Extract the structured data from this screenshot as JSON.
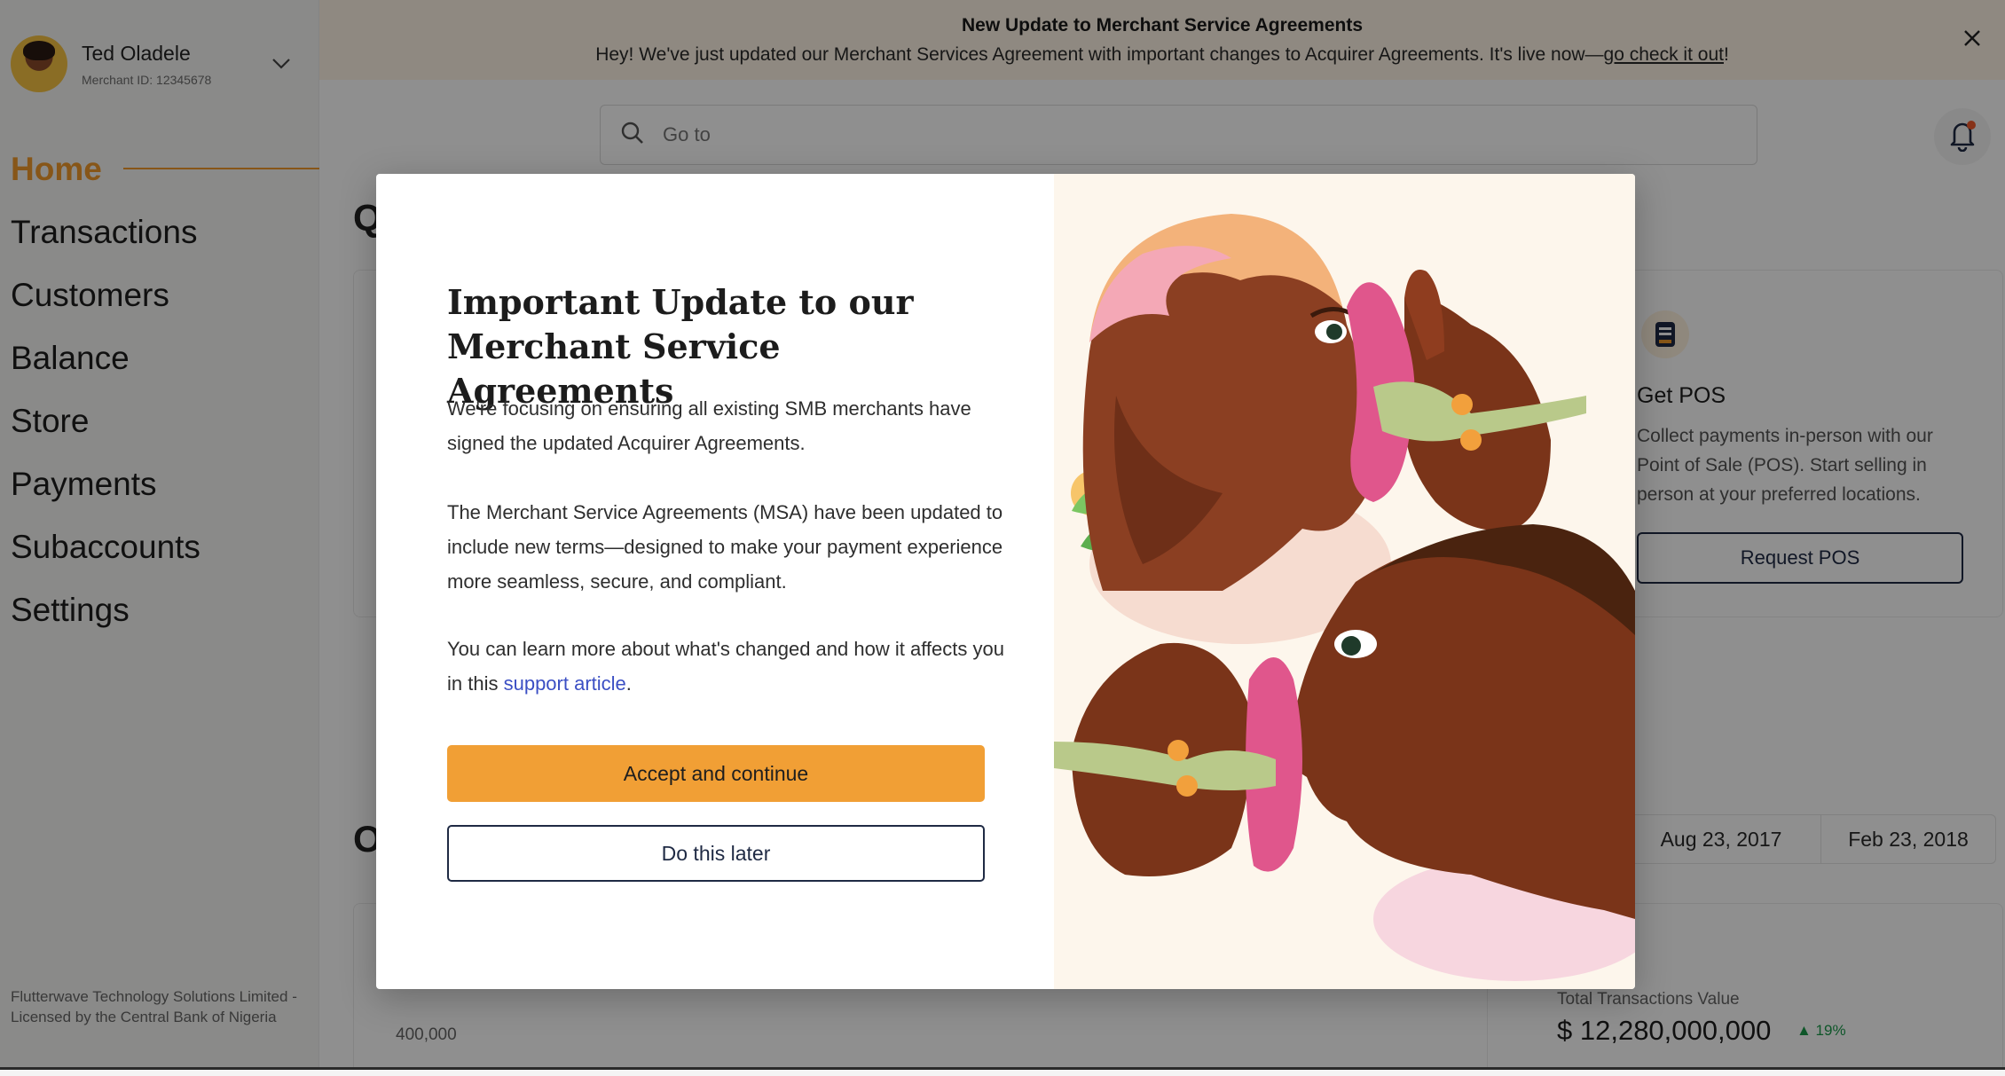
{
  "user": {
    "name": "Ted Oladele",
    "merchant_id": "Merchant ID: 12345678"
  },
  "nav": {
    "items": [
      {
        "label": "Home",
        "active": true
      },
      {
        "label": "Transactions",
        "active": false
      },
      {
        "label": "Customers",
        "active": false
      },
      {
        "label": "Balance",
        "active": false
      },
      {
        "label": "Store",
        "active": false
      },
      {
        "label": "Payments",
        "active": false
      },
      {
        "label": "Subaccounts",
        "active": false
      },
      {
        "label": "Settings",
        "active": false
      }
    ]
  },
  "legal_footer": "Flutterwave Technology Solutions Limited - Licensed by the Central Bank of Nigeria",
  "banner": {
    "title": "New Update to Merchant Service Agreements",
    "text": "Hey! We've just updated our Merchant Services Agreement with important changes to Acquirer Agreements. It's live now—",
    "link": "go check it out",
    "link_suffix": "!"
  },
  "search": {
    "placeholder": "Go to"
  },
  "sections": {
    "quick_heading_initial": "Q",
    "overview_heading_initial": "O"
  },
  "get_pos": {
    "title": "Get POS",
    "description": "Collect payments in-person with our Point of Sale (POS). Start selling in person at your preferred locations.",
    "button": "Request POS"
  },
  "date_range": {
    "from": "Aug 23, 2017",
    "to": "Feb 23, 2018"
  },
  "chart": {
    "y_tick": "400,000"
  },
  "total_transactions": {
    "label": "Total Transactions Value",
    "value": "$ 12,280,000,000",
    "change": "▲ 19%"
  },
  "modal": {
    "title": "Important Update to our Merchant Service Agreements",
    "p1": "We're focusing on ensuring all existing SMB merchants have signed the updated Acquirer Agreements.",
    "p2": "The Merchant Service Agreements (MSA) have been updated to include new terms—designed to make your payment experience more seamless, secure, and compliant.",
    "p3_prefix": "You can learn more about what's changed and how it affects you in this ",
    "p3_link": "support article",
    "p3_suffix": ".",
    "accept_button": "Accept and continue",
    "later_button": "Do this later"
  },
  "colors": {
    "accent": "#f19a2b",
    "accept_button": "#f19f35",
    "navy": "#1f2a44",
    "link": "#3b4fc4",
    "banner_bg": "#fff5e6",
    "illustration_bg": "#fdf6ec"
  },
  "icons": [
    "chevron-down-icon",
    "close-icon",
    "search-icon",
    "bell-icon",
    "pos-terminal-icon"
  ]
}
